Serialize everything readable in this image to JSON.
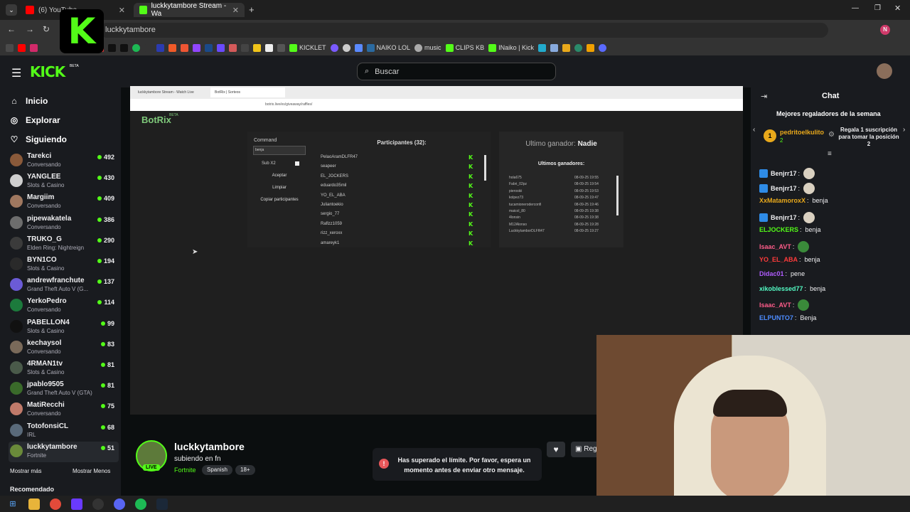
{
  "browser": {
    "tabs": [
      {
        "label": "(6) YouTube",
        "active": false
      },
      {
        "label": "luckkytambore Stream - Wa",
        "active": true
      }
    ],
    "new_tab": "+",
    "url": "luckkytambore",
    "bookmarks": [
      "KICKLET",
      "NAIKO LOL",
      "music",
      "CLIPS KB",
      "INaiko | Kick"
    ],
    "profile_initial": "N"
  },
  "header": {
    "brand": "KICK",
    "beta": "BETA",
    "search_placeholder": "Buscar"
  },
  "nav": [
    {
      "label": "Inicio",
      "icon": "home-icon"
    },
    {
      "label": "Explorar",
      "icon": "compass-icon"
    },
    {
      "label": "Siguiendo",
      "icon": "heart-icon"
    }
  ],
  "channels": [
    {
      "name": "Tarekci",
      "category": "Conversando",
      "viewers": "492",
      "color": "#8a5a3a"
    },
    {
      "name": "YANGLEE",
      "category": "Slots & Casino",
      "viewers": "430",
      "color": "#cfcfcf"
    },
    {
      "name": "Margiim",
      "category": "Conversando",
      "viewers": "409",
      "color": "#a07860"
    },
    {
      "name": "pipewakatela",
      "category": "Conversando",
      "viewers": "386",
      "color": "#6d6d6d"
    },
    {
      "name": "TRUKO_G",
      "category": "Elden Ring: Nightreign",
      "viewers": "290",
      "color": "#3b3b3b"
    },
    {
      "name": "BYN1CO",
      "category": "Slots & Casino",
      "viewers": "194",
      "color": "#2a2a2a"
    },
    {
      "name": "andrewfranchute",
      "category": "Grand Theft Auto V (G...",
      "viewers": "137",
      "color": "#6b5bd6"
    },
    {
      "name": "YerkoPedro",
      "category": "Conversando",
      "viewers": "114",
      "color": "#1c7a3c"
    },
    {
      "name": "PABELLON4",
      "category": "Slots & Casino",
      "viewers": "99",
      "color": "#111111"
    },
    {
      "name": "kechaysol",
      "category": "Conversando",
      "viewers": "83",
      "color": "#7a6a5a"
    },
    {
      "name": "4RMAN1tv",
      "category": "Slots & Casino",
      "viewers": "81",
      "color": "#4a5a4a"
    },
    {
      "name": "jpablo9505",
      "category": "Grand Theft Auto V (GTA)",
      "viewers": "81",
      "color": "#3a6a2a"
    },
    {
      "name": "MatiRecchi",
      "category": "Conversando",
      "viewers": "75",
      "color": "#c07a6a"
    },
    {
      "name": "TotofonsiCL",
      "category": "IRL",
      "viewers": "68",
      "color": "#5a6a7a"
    },
    {
      "name": "luckkytambore",
      "category": "Fortnite",
      "viewers": "51",
      "color": "#6a8a3a"
    }
  ],
  "sidebar_footer": {
    "more": "Mostrar más",
    "less": "Mostrar Menos",
    "recommended": "Recomendado"
  },
  "botrix": {
    "title": "BotRix",
    "beta": "BETA",
    "inner_tabs": [
      "luckkytambore Stream - Watch Live",
      "BotRix | Sorteos"
    ],
    "inner_url": "botrix.live/es/giveaway/raffles/",
    "command_label": "Command",
    "command_value": "benja",
    "sub_label": "Sub X2",
    "buttons": [
      "Aceptar",
      "Limpiar",
      "Copiar participantes"
    ],
    "participants_title": "Participantes (32):",
    "participants": [
      "PelaoAramDLFR47",
      "seapeer",
      "EL_JOCKERS",
      "eduardo35mil",
      "YO_EL_ABA",
      "Juliantoekio",
      "sergio_77",
      "Raflzz1059",
      "rizz_xeroxx",
      "amareyk1"
    ],
    "last_winner_label": "Ultimo ganador:",
    "last_winner_value": "Nadie",
    "winners_title": "Ultimos ganadores:",
    "winners": [
      {
        "name": "hola675",
        "date": "08-09-25 19:55"
      },
      {
        "name": "Fabri_02pz",
        "date": "08-09-25 19:54"
      },
      {
        "name": "pieroskii",
        "date": "08-09-25 19:53"
      },
      {
        "name": "kolpez73",
        "date": "08-09-25 19:47"
      },
      {
        "name": "tucamioneroderconfi",
        "date": "08-09-25 19:46"
      },
      {
        "name": "maicol_80",
        "date": "08-09-25 19:38"
      },
      {
        "name": "4lonsin",
        "date": "08-09-25 19:38"
      },
      {
        "name": "M12Alonso",
        "date": "08-09-25 19:28"
      },
      {
        "name": "LuckkytamborDLFR47",
        "date": "08-09-25 19:27"
      }
    ]
  },
  "stream": {
    "name": "luckkytambore",
    "title": "subiendo en fn",
    "game": "Fortnite",
    "tags": [
      "Spanish",
      "18+"
    ],
    "live": "LIVE",
    "gift_label": "Reg"
  },
  "toast": {
    "text": "Has superado el límite. Por favor, espera un momento antes de enviar otro mensaje."
  },
  "chat": {
    "title": "Chat",
    "gifters_title": "Mejores regaladores de la semana",
    "top_gifter": {
      "rank": "1",
      "name": "pedritoelkulito",
      "count": "2"
    },
    "gift_cta": "Regala 1 suscripción para tomar la posición 2",
    "messages": [
      {
        "user": "Benjrr17",
        "text": "",
        "color": "#efeff1",
        "badge": true,
        "emote": true
      },
      {
        "user": "Benjrr17",
        "text": "",
        "color": "#efeff1",
        "badge": true,
        "emote": true
      },
      {
        "user": "XxMatamoroxX",
        "text": "benja",
        "color": "#e9a91b",
        "badge": false,
        "emote": false
      },
      {
        "user": "Benjrr17",
        "text": "",
        "color": "#efeff1",
        "badge": true,
        "emote": true
      },
      {
        "user": "ELJOCKERS",
        "text": "benja",
        "color": "#53fc18",
        "badge": false,
        "emote": false
      },
      {
        "user": "Isaac_AVT",
        "text": "",
        "color": "#ff5c8a",
        "badge": false,
        "emote": true
      },
      {
        "user": "YO_EL_ABA",
        "text": "benja",
        "color": "#ff3b3b",
        "badge": false,
        "emote": false
      },
      {
        "user": "Didac01",
        "text": "pene",
        "color": "#b05cff",
        "badge": false,
        "emote": false
      },
      {
        "user": "xikoblessed77",
        "text": "benja",
        "color": "#53fcc5",
        "badge": false,
        "emote": false
      },
      {
        "user": "Isaac_AVT",
        "text": "",
        "color": "#ff5c8a",
        "badge": false,
        "emote": true
      },
      {
        "user": "ELPUNTO7",
        "text": "Benja",
        "color": "#4d8cff",
        "badge": false,
        "emote": false
      }
    ]
  },
  "colors": {
    "accent": "#53fc18",
    "bg": "#0b0e0f",
    "panel": "#191b1f"
  }
}
